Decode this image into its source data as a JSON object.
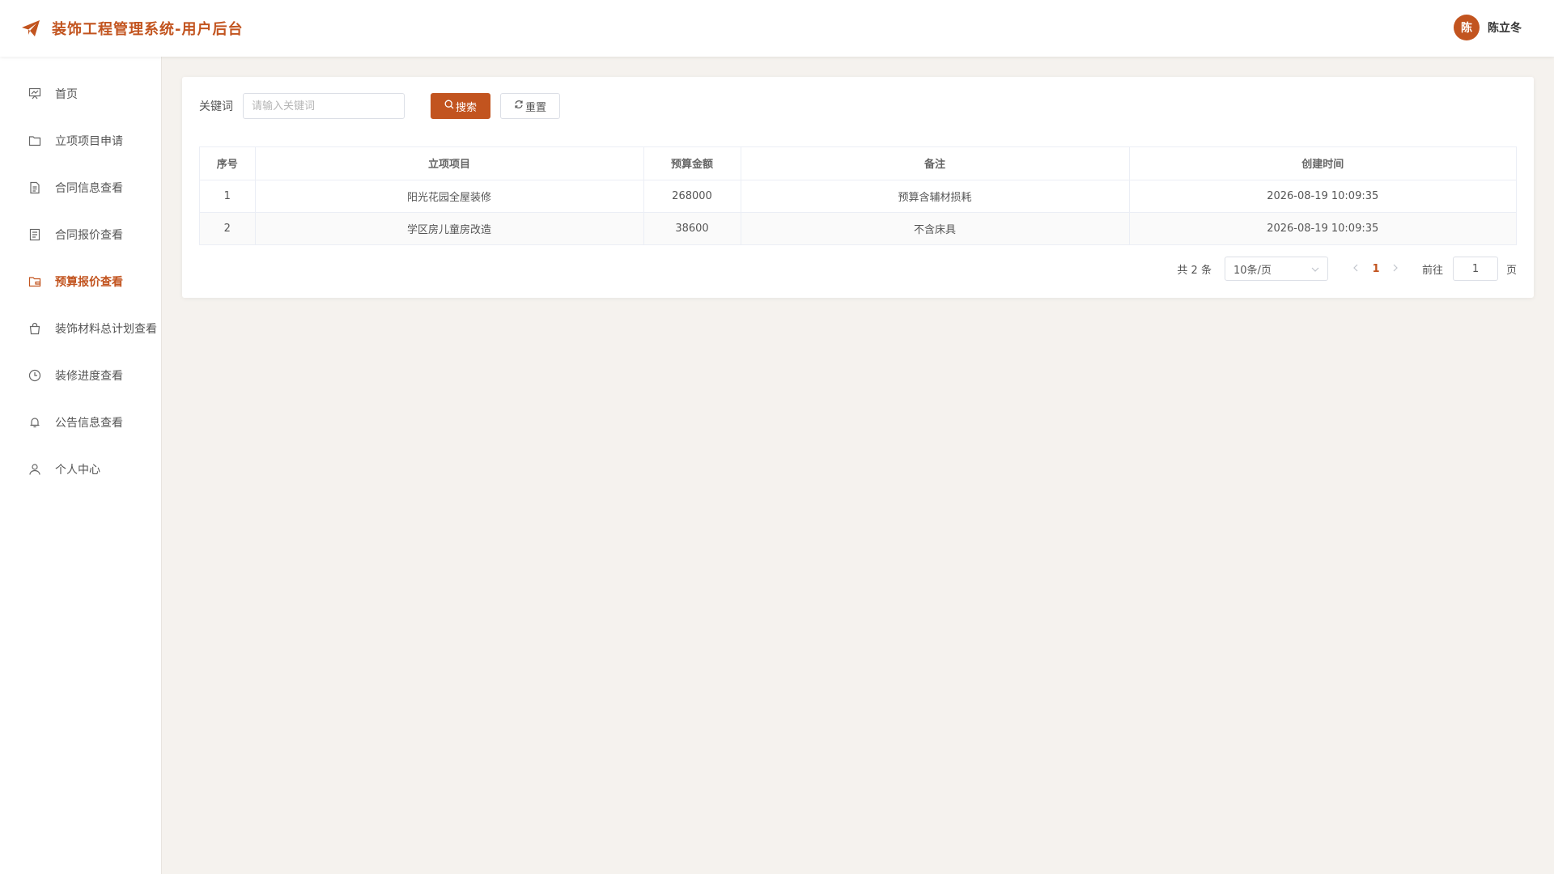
{
  "header": {
    "title": "装饰工程管理系统-用户后台",
    "user": {
      "avatar_text": "陈",
      "name": "陈立冬"
    }
  },
  "sidebar": {
    "items": [
      {
        "label": "首页",
        "icon": "presentation-icon"
      },
      {
        "label": "立项项目申请",
        "icon": "folder-icon"
      },
      {
        "label": "合同信息查看",
        "icon": "document-icon"
      },
      {
        "label": "合同报价查看",
        "icon": "tickets-icon"
      },
      {
        "label": "预算报价查看",
        "icon": "folder-open-icon",
        "active": true
      },
      {
        "label": "装饰材料总计划查看",
        "icon": "shopping-bag-icon"
      },
      {
        "label": "装修进度查看",
        "icon": "clock-icon"
      },
      {
        "label": "公告信息查看",
        "icon": "bell-icon"
      },
      {
        "label": "个人中心",
        "icon": "user-icon"
      }
    ]
  },
  "search": {
    "label": "关键词",
    "placeholder": "请输入关键词",
    "value": "",
    "search_button": "搜索",
    "reset_button": "重置"
  },
  "table": {
    "columns": [
      "序号",
      "立项项目",
      "预算金额",
      "备注",
      "创建时间"
    ],
    "rows": [
      [
        "1",
        "阳光花园全屋装修",
        "268000",
        "预算含辅材损耗",
        "2026-08-19 10:09:35"
      ],
      [
        "2",
        "学区房儿童房改造",
        "38600",
        "不含床具",
        "2026-08-19 10:09:35"
      ]
    ]
  },
  "pagination": {
    "total_text": "共 2 条",
    "page_size": "10条/页",
    "current_page": "1",
    "goto_label": "前往",
    "goto_value": "1",
    "page_unit": "页"
  },
  "colors": {
    "accent": "#c2541f",
    "background": "#f5f2ee"
  }
}
